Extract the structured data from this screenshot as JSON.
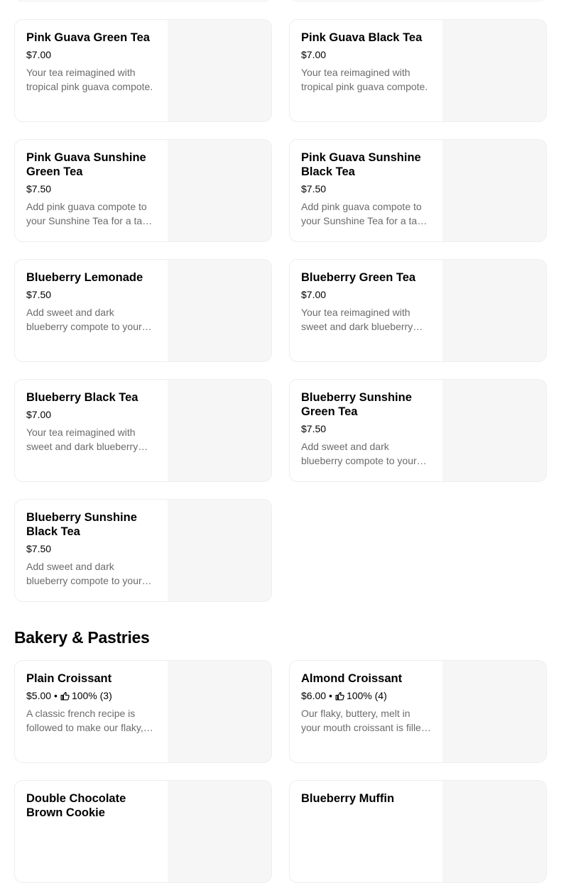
{
  "drinks": [
    {
      "name": "Pink Guava Green Tea",
      "price": "$7.00",
      "description": "Your tea reimagined with tropical pink guava compote."
    },
    {
      "name": "Pink Guava Black Tea",
      "price": "$7.00",
      "description": "Your tea reimagined with tropical pink guava compote."
    },
    {
      "name": "Pink Guava Sunshine Green Tea",
      "price": "$7.50",
      "description": "Add pink guava compote to your Sunshine Tea for a tasty tropical twist."
    },
    {
      "name": "Pink Guava Sunshine Black Tea",
      "price": "$7.50",
      "description": "Add pink guava compote to your Sunshine Tea for a tasty tropical twist."
    },
    {
      "name": "Blueberry Lemonade",
      "price": "$7.50",
      "description": "Add sweet and dark blueberry compote to your lemonade."
    },
    {
      "name": "Blueberry Green Tea",
      "price": "$7.00",
      "description": "Your tea reimagined with sweet and dark blueberry compote."
    },
    {
      "name": "Blueberry Black Tea",
      "price": "$7.00",
      "description": "Your tea reimagined with sweet and dark blueberry compote."
    },
    {
      "name": "Blueberry Sunshine Green Tea",
      "price": "$7.50",
      "description": "Add sweet and dark blueberry compote to your Sunshine Tea."
    },
    {
      "name": "Blueberry Sunshine Black Tea",
      "price": "$7.50",
      "description": "Add sweet and dark blueberry compote to your Sunshine Tea."
    }
  ],
  "bakery": {
    "title": "Bakery & Pastries",
    "items": [
      {
        "name": "Plain Croissant",
        "price": "$5.00",
        "separator": "•",
        "rating": "100% (3)",
        "description": "A classic french recipe is followed to make our flaky, buttery croissants."
      },
      {
        "name": "Almond Croissant",
        "price": "$6.00",
        "separator": "•",
        "rating": "100% (4)",
        "description": "Our flaky, buttery, melt in your mouth croissant is filled with almond cream."
      },
      {
        "name": "Double Chocolate Brown Cookie",
        "price": "",
        "description": ""
      },
      {
        "name": "Blueberry Muffin",
        "price": "",
        "description": ""
      }
    ]
  },
  "icons": {
    "rating": "thumbs-up-icon"
  }
}
